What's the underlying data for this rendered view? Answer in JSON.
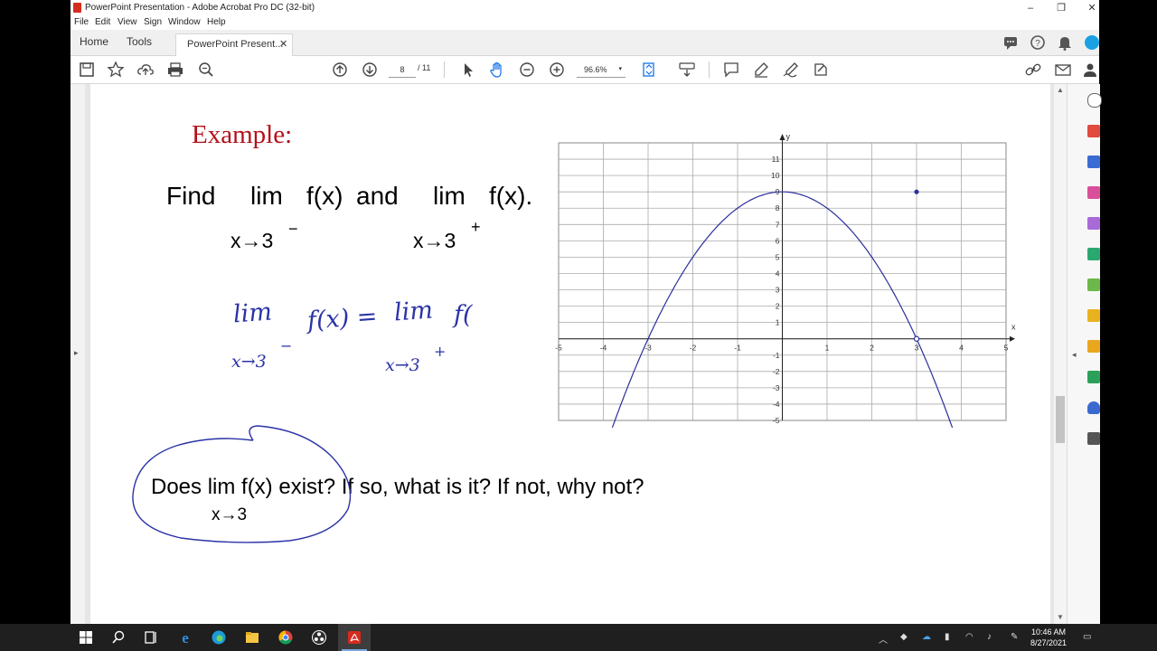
{
  "window": {
    "title": "PowerPoint Presentation - Adobe Acrobat Pro DC (32-bit)",
    "controls": [
      "–",
      "❐",
      "✕"
    ]
  },
  "menu": [
    "File",
    "Edit",
    "View",
    "Sign",
    "Window",
    "Help"
  ],
  "tabs": {
    "home": "Home",
    "tools": "Tools",
    "document": "PowerPoint Present...",
    "close": "✕"
  },
  "toolbar": {
    "page_current": "8",
    "page_total": "/ 11",
    "zoom": "96.6%",
    "zoom_caret": "▾"
  },
  "slide": {
    "heading": "Example:",
    "find_word": "Find",
    "lim1": "lim",
    "fx1": "f(x)",
    "and_word": "and",
    "lim2": "lim",
    "fx2": "f(x).",
    "sub1": "x→3",
    "sup1": "−",
    "sub2": "x→3",
    "sup2": "+",
    "question": "Does  lim f(x) exist? If so, what is it? If not, why not?",
    "question_sub": "x→3"
  },
  "handwriting": {
    "lim_a": "lim",
    "f_eq": "f(x) =",
    "lim_b": "lim",
    "f_b": "f(",
    "sub_a": "x→3",
    "sup_a": "−",
    "sub_b": "x→3",
    "sup_b": "+"
  },
  "chart_data": {
    "type": "line",
    "function": "f(x) = 9 - x^2 for x != 3; f(3) = 9",
    "x": [
      -3.8,
      -3,
      -2,
      -1,
      0,
      1,
      2,
      3,
      3.8
    ],
    "y": [
      -5.44,
      0,
      5,
      8,
      9,
      8,
      5,
      0,
      -5.44
    ],
    "open_point": [
      3,
      0
    ],
    "closed_point": [
      3,
      9
    ],
    "xlim": [
      -5,
      5
    ],
    "ylim": [
      -5,
      11
    ],
    "xlabel": "x",
    "ylabel": "y",
    "x_ticks": [
      "-5",
      "-4",
      "-3",
      "-2",
      "-1",
      "1",
      "2",
      "3",
      "4",
      "5"
    ],
    "y_ticks": [
      "11",
      "10",
      "9",
      "8",
      "7",
      "6",
      "5",
      "4",
      "3",
      "2",
      "1",
      "-1",
      "-2",
      "-3",
      "-4",
      "-5"
    ],
    "grid": true,
    "curve_color": "#2b2f9c"
  },
  "taskbar": {
    "time": "10:46 AM",
    "date": "8/27/2021"
  },
  "colors": {
    "heading": "#b5101a",
    "ink": "#2b33a6",
    "accent": "#d62b1f"
  }
}
